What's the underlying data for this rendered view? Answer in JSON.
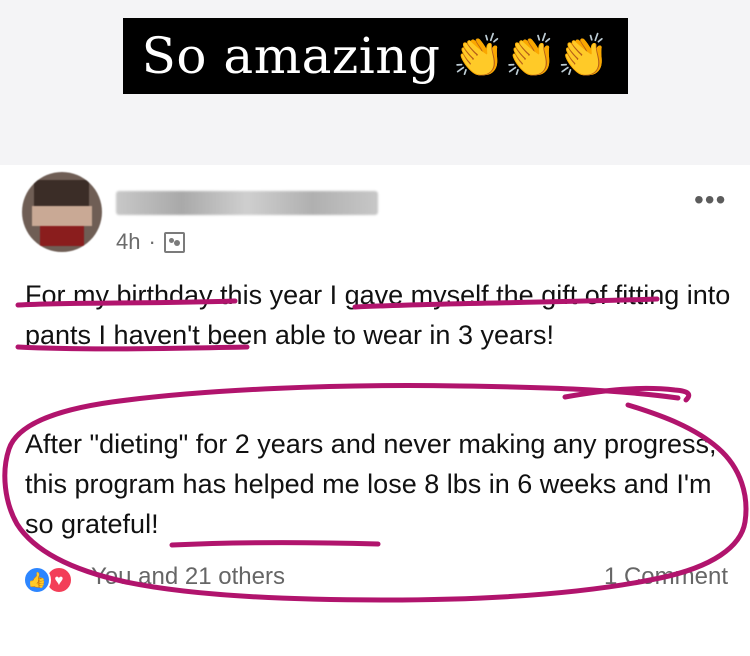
{
  "banner": {
    "text": "So amazing",
    "emoji": "👏👏👏"
  },
  "post": {
    "time": "4h",
    "separator": "·",
    "menu_icon": "•••",
    "paragraph_1": "For my birthday this year I gave myself the gift of fitting into pants I haven't been able to wear in 3 years!",
    "paragraph_2": "After \"dieting\" for 2 years and never making any progress, this program has helped me lose 8 lbs in 6 weeks and I'm so grateful!",
    "reactions_label": "You and 21 others",
    "comments_label": "1 Comment"
  },
  "colors": {
    "banner_background": "#000000",
    "banner_text": "#ffffff",
    "annotation_magenta": "#b1146d",
    "like_blue": "#2d86ff",
    "love_red": "#f33e58"
  }
}
